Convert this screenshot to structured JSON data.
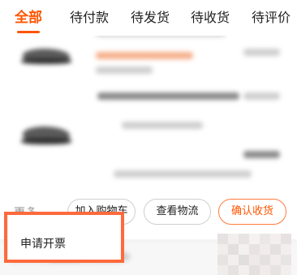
{
  "tabs": [
    {
      "label": "全部",
      "active": true
    },
    {
      "label": "待付款",
      "active": false
    },
    {
      "label": "待发货",
      "active": false
    },
    {
      "label": "待收货",
      "active": false
    },
    {
      "label": "待评价",
      "active": false
    }
  ],
  "order_card": {
    "more_label": "更多",
    "actions": {
      "add_to_cart": "加入购物车",
      "view_logistics": "查看物流",
      "confirm_receipt": "确认收货"
    }
  },
  "popup_menu": {
    "items": [
      "申请开票"
    ]
  },
  "colors": {
    "accent": "#ff5500",
    "highlight": "#ff6a3c",
    "confirm_border": "#ff7a3d"
  }
}
